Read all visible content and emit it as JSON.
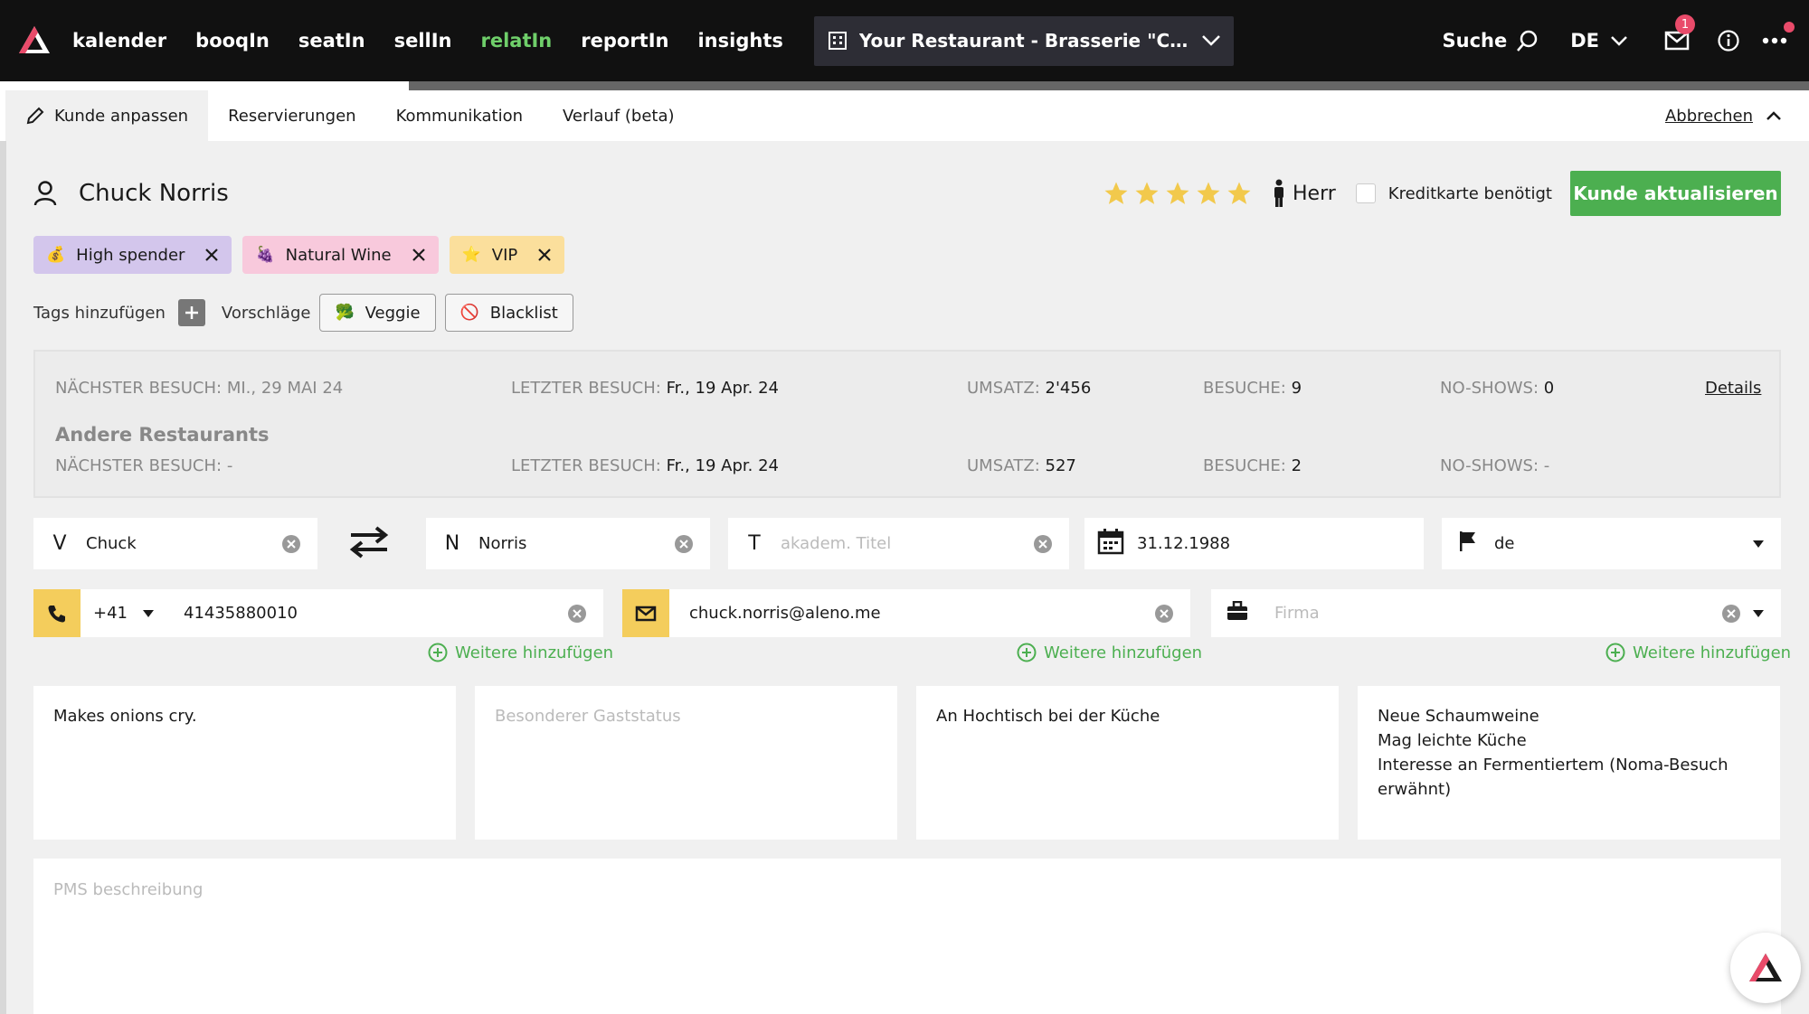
{
  "nav": {
    "items": [
      "kalender",
      "booqIn",
      "seatIn",
      "sellIn",
      "relatIn",
      "reportIn",
      "insights"
    ],
    "active": "relatIn",
    "restaurant": "Your Restaurant - Brasserie \"Chez Fr...",
    "search_label": "Suche",
    "language": "DE",
    "mail_count": "1"
  },
  "tabs": {
    "items": [
      "Kunde anpassen",
      "Reservierungen",
      "Kommunikation",
      "Verlauf (beta)"
    ],
    "cancel_label": "Abbrechen"
  },
  "guest": {
    "name": "Chuck Norris",
    "rating": 5,
    "salutation": "Herr",
    "credit_card_label": "Kreditkarte benötigt",
    "credit_card_checked": false,
    "update_label": "Kunde aktualisieren"
  },
  "tags": [
    {
      "emoji": "💰",
      "label": "High spender"
    },
    {
      "emoji": "🍇",
      "label": "Natural Wine"
    },
    {
      "emoji": "⭐",
      "label": "VIP"
    }
  ],
  "tag_actions": {
    "add_label": "Tags hinzufügen",
    "suggestions_label": "Vorschläge",
    "suggestions": [
      {
        "emoji": "🥦",
        "label": "Veggie"
      },
      {
        "emoji": "🚫",
        "label": "Blacklist"
      }
    ]
  },
  "stats": {
    "next_visit_label": "NÄCHSTER BESUCH:",
    "next_visit": "MI., 29 MAI 24",
    "last_visit_label": "LETZTER BESUCH:",
    "last_visit": "Fr., 19 Apr. 24",
    "revenue_label": "UMSATZ:",
    "revenue": "2'456",
    "visits_label": "BESUCHE:",
    "visits": "9",
    "noshows_label": "NO-SHOWS:",
    "noshows": "0",
    "details_label": "Details",
    "other_title": "Andere Restaurants",
    "other_next_visit": "-",
    "other_last_visit": "Fr., 19 Apr. 24",
    "other_revenue": "527",
    "other_visits": "2",
    "other_noshows": "-"
  },
  "form": {
    "first_name_prefix": "V",
    "first_name": "Chuck",
    "last_name_prefix": "N",
    "last_name": "Norris",
    "title_prefix": "T",
    "title_placeholder": "akadem. Titel",
    "birthday": "31.12.1988",
    "language": "de",
    "phone_country": "+41",
    "phone": "41435880010",
    "email": "chuck.norris@aleno.me",
    "company_placeholder": "Firma",
    "add_more_label": "Weitere hinzufügen"
  },
  "notes": {
    "note1": "Makes onions cry.",
    "note2_placeholder": "Besonderer Gaststatus",
    "note3": "An Hochtisch bei der Küche",
    "note4_lines": [
      "Neue Schaumweine",
      "Mag leichte Küche",
      "Interesse an Fermentiertem (Noma-Besuch",
      "erwähnt)"
    ],
    "pms_placeholder": "PMS beschreibung"
  },
  "colors": {
    "accent_green": "#4caf50",
    "nav_active": "#6fcf6a",
    "badge": "#e94b6a",
    "phone_yellow": "#f4cd5c",
    "star": "#f2c94c"
  }
}
